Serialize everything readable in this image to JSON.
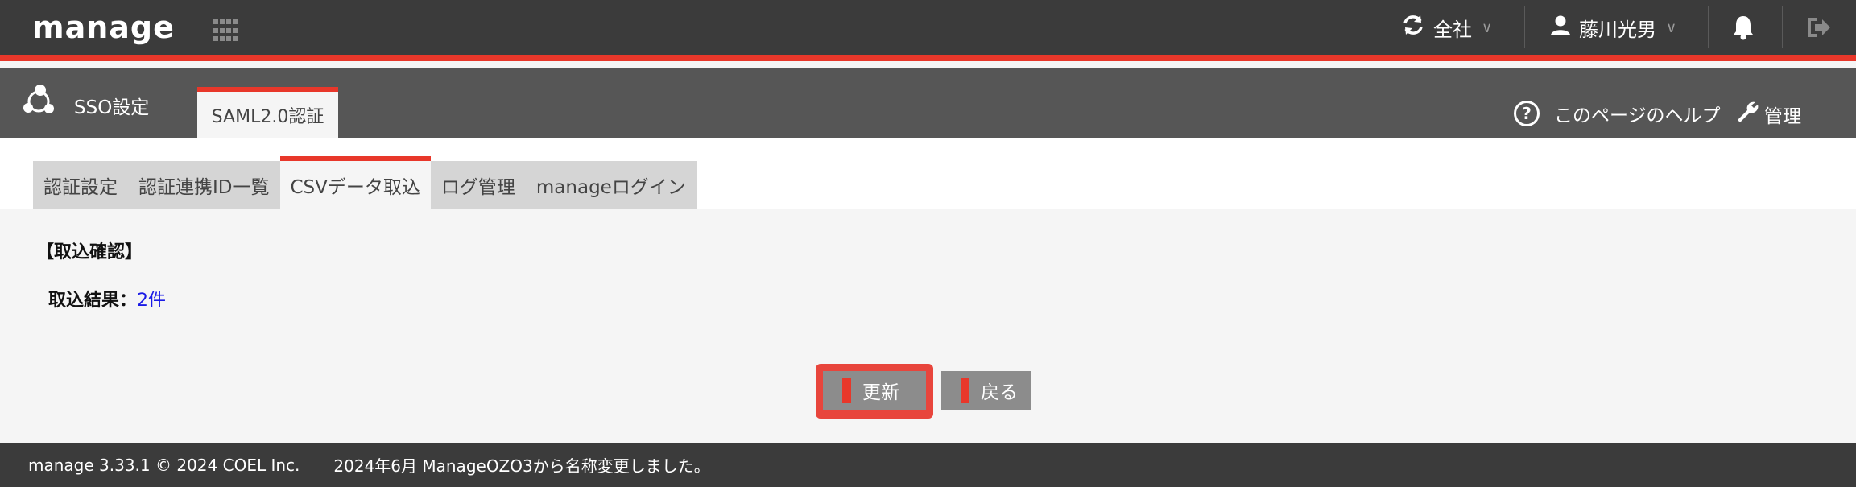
{
  "topbar": {
    "logo": "manage",
    "company": "全社",
    "user": "藤川光男",
    "accent_color": "#e8372a"
  },
  "subheader": {
    "title": "SSO設定",
    "active_tab": "SAML2.0認証",
    "help": "このページのヘルプ",
    "admin": "管理"
  },
  "tabs": [
    {
      "label": "認証設定"
    },
    {
      "label": "認証連携ID一覧"
    },
    {
      "label": "CSVデータ取込"
    },
    {
      "label": "ログ管理"
    },
    {
      "label": "manageログイン"
    }
  ],
  "main": {
    "heading": "【取込確認】",
    "result_label": "取込結果：",
    "result_value": "2件",
    "update_button": "更新",
    "back_button": "戻る"
  },
  "footer": {
    "version": "manage 3.33.1 © 2024 COEL Inc.",
    "notice": "2024年6月 ManageOZO3から名称変更しました。"
  }
}
